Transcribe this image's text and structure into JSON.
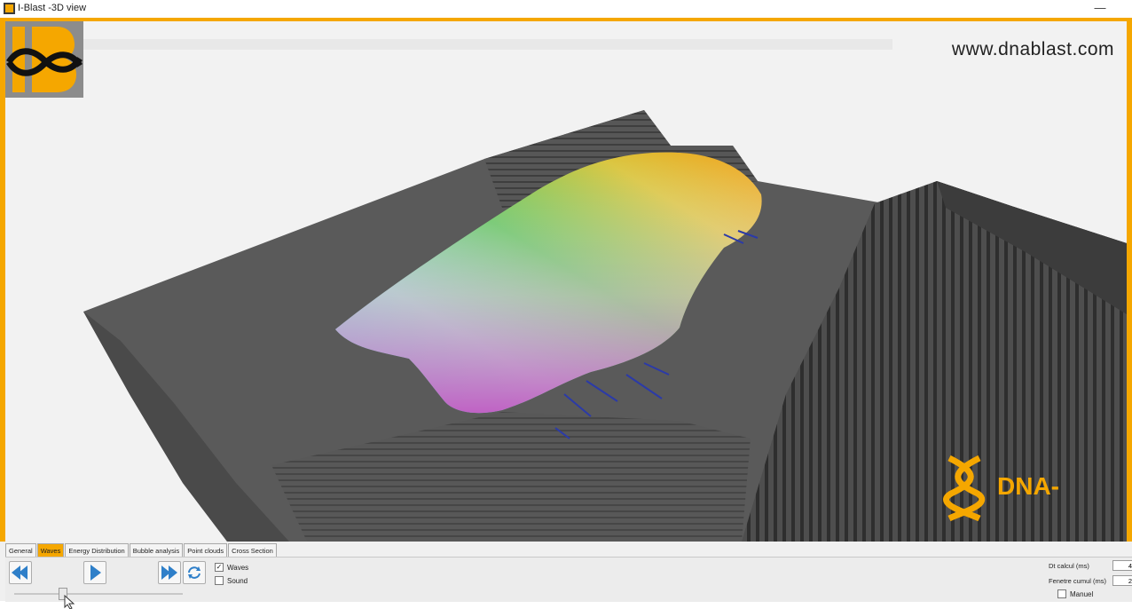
{
  "window": {
    "title": "I-Blast -3D view",
    "minimize_symbol": "—"
  },
  "watermark": "www.dnablast.com",
  "logos": {
    "left": "IB",
    "right": "DNA-"
  },
  "tabs": [
    "General",
    "Waves",
    "Energy Distribution",
    "Bubble analysis",
    "Point clouds",
    "Cross Section"
  ],
  "active_tab": "Waves",
  "controls": {
    "waves_label": "Waves",
    "waves_checked": true,
    "sound_label": "Sound",
    "sound_checked": false,
    "dt_calcul_label": "Dt calcul (ms)",
    "dt_calcul_value": "4",
    "fenetre_label": "Fenetre cumul (ms)",
    "fenetre_value": "2",
    "manuel_label": "Manuel"
  },
  "icons": {
    "rewind": "rewind-icon",
    "play": "play-icon",
    "fast_forward": "fast-forward-icon",
    "refresh": "refresh-icon"
  },
  "colors": {
    "accent": "#f5a700",
    "terrain": "#555555",
    "background": "#f2f2f2"
  }
}
